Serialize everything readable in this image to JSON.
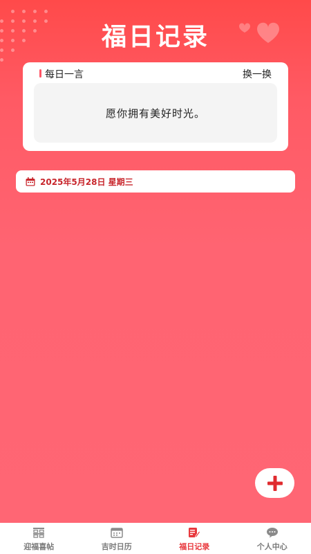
{
  "header": {
    "title": "福日记录"
  },
  "quote": {
    "label": "每日一言",
    "refresh_label": "换一换",
    "text": "愿你拥有美好时光。"
  },
  "date": {
    "text": "2025年5月28日 星期三"
  },
  "fab": {
    "icon": "plus-icon"
  },
  "tabbar": {
    "tabs": [
      {
        "label": "迎福喜帖",
        "icon": "double-happiness-icon",
        "active": false
      },
      {
        "label": "吉时日历",
        "icon": "calendar-icon",
        "active": false
      },
      {
        "label": "福日记录",
        "icon": "note-edit-icon",
        "active": true
      },
      {
        "label": "个人中心",
        "icon": "chat-bubble-icon",
        "active": false
      }
    ]
  },
  "colors": {
    "accent": "#e8383d",
    "background": "#ff6472",
    "date_text": "#c8262c"
  }
}
